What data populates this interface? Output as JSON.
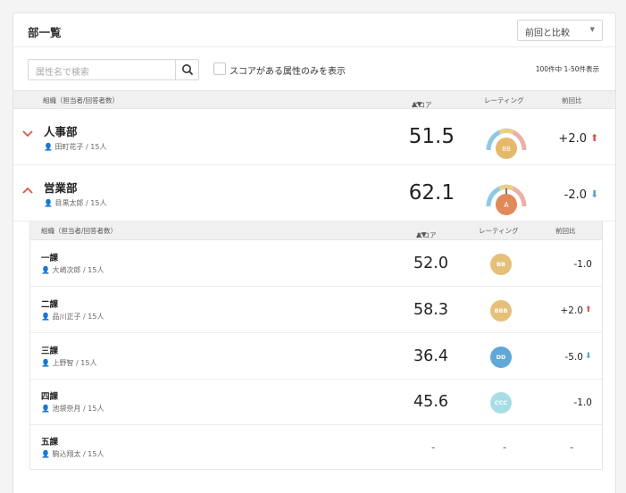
{
  "header": {
    "title": "部一覧",
    "compare_select": "前回と比較"
  },
  "toolbar": {
    "search_placeholder": "属性名で検索",
    "filter_label": "スコアがある属性のみを表示",
    "count_text": "100件中 1-50件表示"
  },
  "table_header": {
    "org": "組織（担当者/回答者数）",
    "score": "スコア",
    "rating": "レーティング",
    "diff": "前回比"
  },
  "departments": [
    {
      "name": "人事部",
      "person": "田町花子 / 15人",
      "score": "51.5",
      "rating": "BB",
      "rating_color": "#e5b96b",
      "diff": "+2.0",
      "trend": "up",
      "expanded": false
    },
    {
      "name": "営業部",
      "person": "目黒太郎 / 15人",
      "score": "62.1",
      "rating": "A",
      "rating_color": "#e08a5a",
      "diff": "-2.0",
      "trend": "down",
      "expanded": true
    }
  ],
  "sub_header": {
    "org": "組織（担当者/回答者数）",
    "score": "スコア",
    "rating": "レーティング",
    "diff": "前回比"
  },
  "sections": [
    {
      "name": "一課",
      "person": "大崎次郎 / 15人",
      "score": "52.0",
      "rating": "BB",
      "rating_color": "#e5c078",
      "diff": "-1.0",
      "trend": "none"
    },
    {
      "name": "二課",
      "person": "品川正子 / 15人",
      "score": "58.3",
      "rating": "BBB",
      "rating_color": "#e5c078",
      "diff": "+2.0",
      "trend": "up"
    },
    {
      "name": "三課",
      "person": "上野智 / 15人",
      "score": "36.4",
      "rating": "DD",
      "rating_color": "#5fa8d8",
      "diff": "-5.0",
      "trend": "down"
    },
    {
      "name": "四課",
      "person": "池袋奈月 / 15人",
      "score": "45.6",
      "rating": "CCC",
      "rating_color": "#a8dde6",
      "diff": "-1.0",
      "trend": "none"
    },
    {
      "name": "五課",
      "person": "駒込翔太 / 15人",
      "score": "-",
      "rating": "-",
      "rating_color": "",
      "diff": "-",
      "trend": "none"
    }
  ],
  "colors": {
    "accent_up": "#d9534f",
    "accent_down": "#5b9bd5",
    "chevron": "#d9573f"
  }
}
